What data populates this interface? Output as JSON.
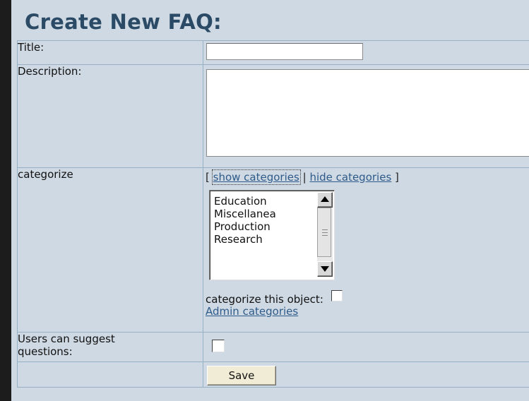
{
  "page": {
    "heading": "Create New FAQ:"
  },
  "form": {
    "title_label": "Title:",
    "title_value": "",
    "description_label": "Description:",
    "description_value": "",
    "categorize_label": "categorize",
    "cat_links": {
      "open_bracket": "[",
      "show": "show categories",
      "separator": "|",
      "hide": "hide categories",
      "close_bracket": "]"
    },
    "categories": [
      "Education",
      "Miscellanea",
      "Production",
      "Research"
    ],
    "categorize_object_label": "categorize this object:",
    "admin_link": "Admin categories",
    "suggest_label_1": "Users can suggest",
    "suggest_label_2": "questions:",
    "save_label": "Save"
  },
  "colors": {
    "background": "#cfd9e3",
    "heading": "#2a4a66",
    "link": "#2e5b8a",
    "button": "#f1ecd6"
  }
}
